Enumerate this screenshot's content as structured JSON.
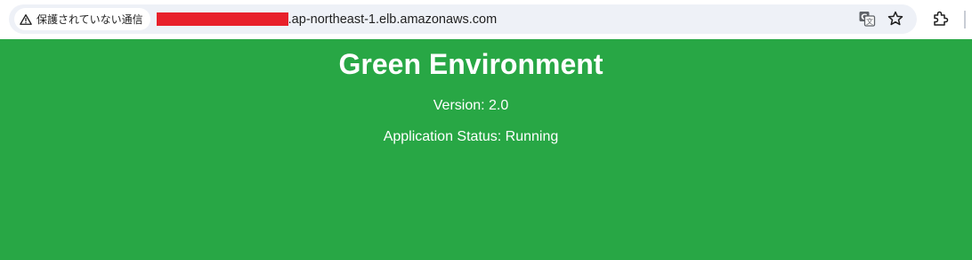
{
  "browser": {
    "security_label": "保護されていない通信",
    "url_visible": ".ap-northeast-1.elb.amazonaws.com",
    "url_redacted": true,
    "icons": {
      "security": "warning-triangle",
      "translate": "translate",
      "bookmark": "star-outline",
      "extensions": "puzzle-piece"
    }
  },
  "page": {
    "title": "Green Environment",
    "version": "Version: 2.0",
    "status": "Application Status: Running",
    "background_color": "#28a745",
    "text_color": "#ffffff"
  }
}
